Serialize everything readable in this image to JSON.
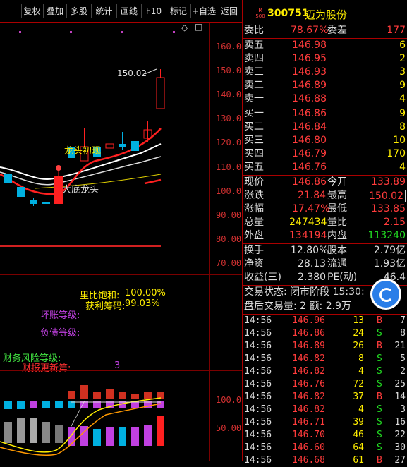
{
  "toolbar": {
    "items": [
      "复权",
      "叠加",
      "多股",
      "统计",
      "画线",
      "F10",
      "标记",
      "+自选",
      "返回"
    ]
  },
  "price_axis": {
    "labels": [
      "160.00",
      "150.00",
      "140.00",
      "130.00",
      "120.00",
      "110.00",
      "100.00",
      "90.00",
      "80.00",
      "70.00"
    ]
  },
  "kline": {
    "high_marker": "150.02",
    "note_top": "龙头初现",
    "note_bottom": "大底龙头"
  },
  "finance": {
    "line1": "里比饱和:",
    "line1_val": "100.00%",
    "line2": "获利筹码:",
    "line2_val": "99.03%",
    "bad_debt": "坏账等级:",
    "liab": "负债等级:",
    "risk": "财务风险等级:",
    "update": "财报更新第:",
    "update_val": "3"
  },
  "indicator_axis": {
    "labels": [
      "100.0",
      "50.00"
    ]
  },
  "stock": {
    "badge_top": "R",
    "badge_bottom": "500",
    "code": "300751",
    "name": "迈为股份"
  },
  "order": {
    "ratio_label": "委比",
    "ratio_val": "78.67%",
    "diff_label": "委差",
    "diff_val": "177",
    "sells": [
      {
        "label": "卖五",
        "price": "146.98",
        "vol": "6"
      },
      {
        "label": "卖四",
        "price": "146.95",
        "vol": "2"
      },
      {
        "label": "卖三",
        "price": "146.93",
        "vol": "3"
      },
      {
        "label": "卖二",
        "price": "146.89",
        "vol": "9"
      },
      {
        "label": "卖一",
        "price": "146.88",
        "vol": "4"
      }
    ],
    "buys": [
      {
        "label": "买一",
        "price": "146.86",
        "vol": "9"
      },
      {
        "label": "买二",
        "price": "146.84",
        "vol": "8"
      },
      {
        "label": "买三",
        "price": "146.80",
        "vol": "10"
      },
      {
        "label": "买四",
        "price": "146.79",
        "vol": "170"
      },
      {
        "label": "买五",
        "price": "146.76",
        "vol": "4"
      }
    ]
  },
  "quote": {
    "rows": [
      {
        "l1": "现价",
        "v1": "146.86",
        "c1": "red",
        "l2": "今开",
        "v2": "133.89",
        "c2": "red"
      },
      {
        "l1": "涨跌",
        "v1": "21.84",
        "c1": "red",
        "l2": "最高",
        "v2": "150.02",
        "c2": "red"
      },
      {
        "l1": "涨幅",
        "v1": "17.47%",
        "c1": "red",
        "l2": "最低",
        "v2": "133.85",
        "c2": "red"
      },
      {
        "l1": "总量",
        "v1": "247434",
        "c1": "yellow",
        "l2": "量比",
        "v2": "2.15",
        "c2": "red"
      },
      {
        "l1": "外盘",
        "v1": "134194",
        "c1": "red",
        "l2": "内盘",
        "v2": "113240",
        "c2": "green"
      }
    ],
    "rows2": [
      {
        "l1": "换手",
        "v1": "12.80%",
        "l2": "股本",
        "v2": "2.79亿"
      },
      {
        "l1": "净资",
        "v1": "28.13",
        "l2": "流通",
        "v2": "1.93亿"
      },
      {
        "l1": "收益(三)",
        "v1": "2.380",
        "l2": "PE(动)",
        "v2": "46.4"
      }
    ],
    "status_line": "交易状态: 闭市阶段 15:30:",
    "after_hours": "盘后交易量: 2  额: 2.9万"
  },
  "ticks": [
    {
      "time": "14:56",
      "price": "146.96",
      "vol": "13",
      "side": "B",
      "num": "7"
    },
    {
      "time": "14:56",
      "price": "146.86",
      "vol": "24",
      "side": "S",
      "num": "8"
    },
    {
      "time": "14:56",
      "price": "146.89",
      "vol": "26",
      "side": "B",
      "num": "21"
    },
    {
      "time": "14:56",
      "price": "146.82",
      "vol": "8",
      "side": "S",
      "num": "5"
    },
    {
      "time": "14:56",
      "price": "146.82",
      "vol": "4",
      "side": "S",
      "num": "2"
    },
    {
      "time": "14:56",
      "price": "146.76",
      "vol": "72",
      "side": "S",
      "num": "25"
    },
    {
      "time": "14:56",
      "price": "146.82",
      "vol": "37",
      "side": "B",
      "num": "14"
    },
    {
      "time": "14:56",
      "price": "146.82",
      "vol": "4",
      "side": "S",
      "num": "3"
    },
    {
      "time": "14:56",
      "price": "146.71",
      "vol": "39",
      "side": "S",
      "num": "16"
    },
    {
      "time": "14:56",
      "price": "146.70",
      "vol": "46",
      "side": "S",
      "num": "22"
    },
    {
      "time": "14:56",
      "price": "146.60",
      "vol": "64",
      "side": "S",
      "num": "30"
    },
    {
      "time": "14:56",
      "price": "146.68",
      "vol": "61",
      "side": "B",
      "num": "27"
    }
  ]
}
